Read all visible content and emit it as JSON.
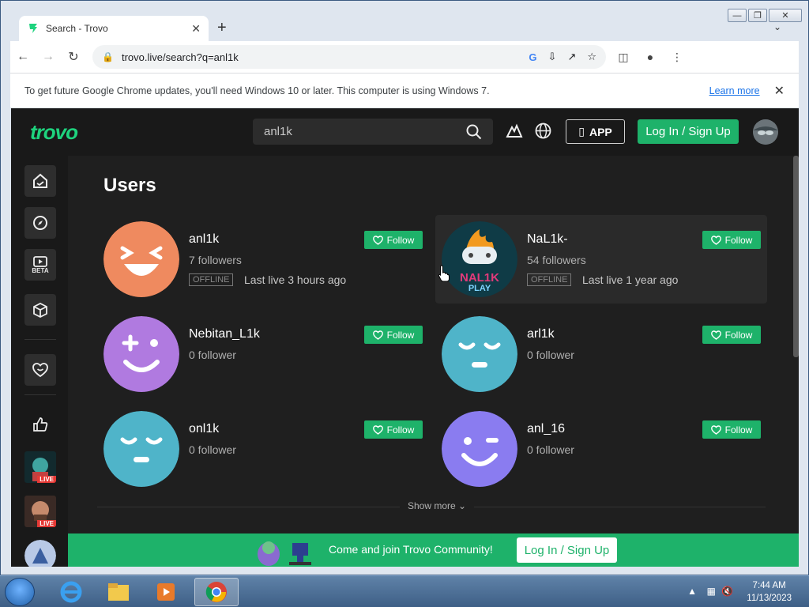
{
  "browser": {
    "tab_title": "Search - Trovo",
    "url": "trovo.live/search?q=anl1k",
    "infobar_message": "To get future Google Chrome updates, you'll need Windows 10 or later. This computer is using Windows 7.",
    "infobar_link": "Learn more"
  },
  "trovo": {
    "logo": "trovo",
    "search_query": "anl1k",
    "app_label": "APP",
    "login_label": "Log In / Sign Up",
    "sidebar": {
      "beta_label": "BETA",
      "live_label": "LIVE"
    },
    "section_title": "Users",
    "follow_label": "Follow",
    "users": [
      {
        "name": "anl1k",
        "followers": "7 followers",
        "status": "OFFLINE",
        "last_live": "Last live 3 hours ago"
      },
      {
        "name": "NaL1k-",
        "followers": "54 followers",
        "status": "OFFLINE",
        "last_live": "Last live 1 year ago",
        "avatar_text_1": "NAL1K",
        "avatar_text_2": "PLAY"
      },
      {
        "name": "Nebitan_L1k",
        "followers": "0 follower"
      },
      {
        "name": "arl1k",
        "followers": "0 follower"
      },
      {
        "name": "onl1k",
        "followers": "0 follower"
      },
      {
        "name": "anl_16",
        "followers": "0 follower"
      }
    ],
    "show_more": "Show more",
    "banner_message": "Come and join Trovo Community!",
    "banner_button": "Log In / Sign Up"
  },
  "taskbar": {
    "time": "7:44 AM",
    "date": "11/13/2023"
  },
  "colors": {
    "trovo_green": "#1eb26a",
    "page_bg": "#1f1f1f",
    "avatar_orange": "#ef8a5f",
    "avatar_purple": "#b07ae0",
    "avatar_teal": "#4fb4c9",
    "avatar_violet": "#8a7cf0"
  }
}
